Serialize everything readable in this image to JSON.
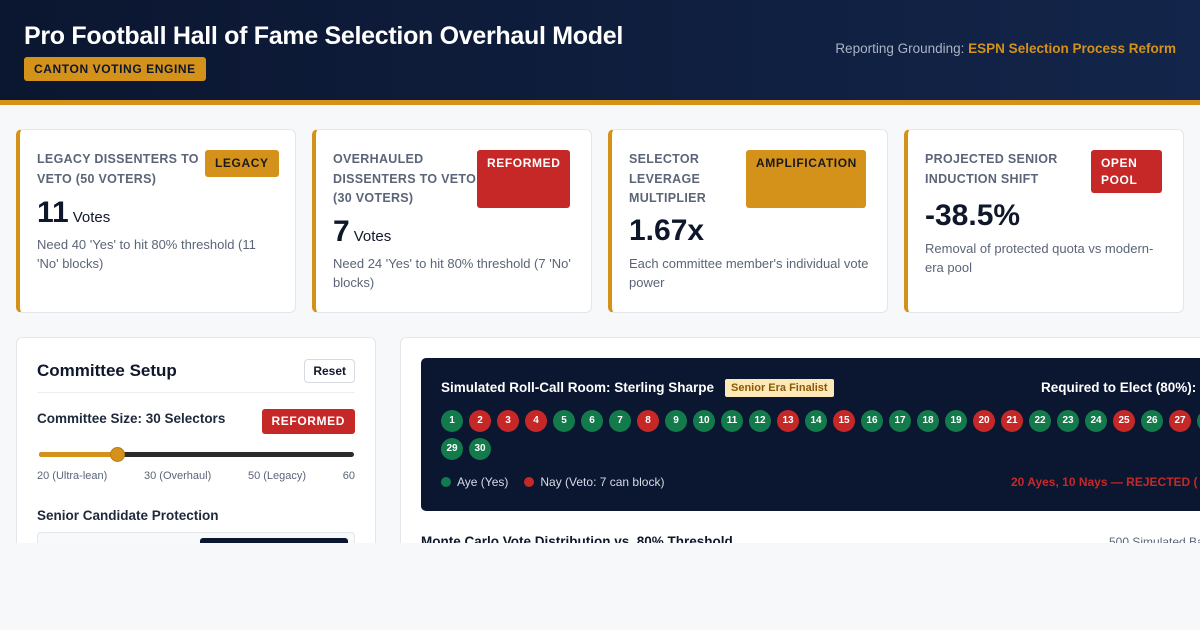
{
  "header": {
    "title": "Pro Football Hall of Fame Selection Overhaul Model",
    "badge": "CANTON VOTING ENGINE",
    "source_label": "Reporting Grounding:",
    "source_name": "ESPN Selection Process Reform"
  },
  "cards": [
    {
      "label": "LEGACY DISSENTERS TO VETO (50 VOTERS)",
      "tag": "LEGACY",
      "value": "11",
      "unit": "Votes",
      "note": "Need 40 'Yes' to hit 80% threshold (11 'No' blocks)"
    },
    {
      "label": "OVERHAULED DISSENTERS TO VETO (30 VOTERS)",
      "tag": "REFORMED",
      "value": "7",
      "unit": "Votes",
      "note": "Need 24 'Yes' to hit 80% threshold (7 'No' blocks)"
    },
    {
      "label": "SELECTOR LEVERAGE MULTIPLIER",
      "tag": "AMPLIFICATION",
      "value": "1.67x",
      "unit": "",
      "note": "Each committee member's individual vote power"
    },
    {
      "label": "PROJECTED SENIOR INDUCTION SHIFT",
      "tag": "OPEN POOL",
      "value": "-38.5%",
      "unit": "",
      "note": "Removal of protected quota vs modern-era pool"
    }
  ],
  "setup": {
    "title": "Committee Setup",
    "reset_label": "Reset",
    "size_label": "Committee Size: 30 Selectors",
    "size_tag": "REFORMED",
    "slider": {
      "min": 20,
      "max": 60,
      "value": 30
    },
    "ticks": [
      "20 (Ultra-lean)",
      "30 (Overhaul)",
      "50 (Legacy)",
      "60"
    ],
    "protection_label": "Senior Candidate Protection"
  },
  "rollcall": {
    "title": "Simulated Roll-Call Room: Sterling Sharpe",
    "badge": "Senior Era Finalist",
    "required_label": "Required to Elect (80%):",
    "nay_seats": [
      2,
      3,
      4,
      8,
      13,
      15,
      20,
      21,
      25,
      27
    ],
    "total_seats": 30,
    "legend_aye": "Aye (Yes)",
    "legend_nay": "Nay (Veto: 7 can block)",
    "result": "20 Ayes, 10 Nays — REJECTED (",
    "colors": {
      "aye": "#127a4b",
      "nay": "#c62828"
    }
  },
  "montecarlo": {
    "title": "Monte Carlo Vote Distribution vs. 80% Threshold",
    "meta": "500 Simulated Ba"
  }
}
